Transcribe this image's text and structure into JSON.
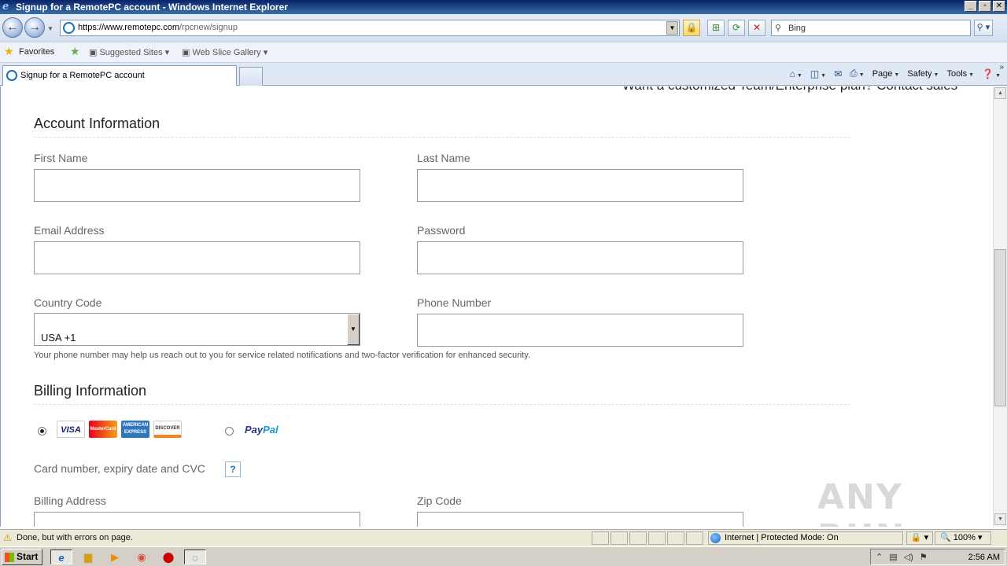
{
  "window": {
    "title": "Signup for a RemotePC account - Windows Internet Explorer",
    "buttons": [
      "_",
      "▫",
      "✕"
    ]
  },
  "nav": {
    "url_host": "https://www.remotepc.com",
    "url_path": "/rpcnew/signup",
    "search_placeholder": "Bing"
  },
  "favorites": {
    "favorites_label": "Favorites",
    "suggested_sites": "Suggested Sites",
    "web_slice_gallery": "Web Slice Gallery"
  },
  "tab": {
    "title": "Signup for a RemotePC account"
  },
  "commandbar": {
    "page": "Page",
    "safety": "Safety",
    "tools": "Tools"
  },
  "form": {
    "top_cutoff_text": "Want a customized Team/Enterprise plan? Contact sales",
    "account_section_title": "Account Information",
    "first_name_label": "First Name",
    "last_name_label": "Last Name",
    "email_label": "Email Address",
    "password_label": "Password",
    "country_code_label": "Country Code",
    "country_code_value": "USA +1",
    "phone_label": "Phone Number",
    "phone_hint": "Your phone number may help us reach out to you for service related notifications and two-factor verification for enhanced security.",
    "billing_section_title": "Billing Information",
    "card_visa": "VISA",
    "card_mastercard": "MasterCard",
    "card_amex": "AMERICAN EXPRESS",
    "card_discover": "DISCOVER",
    "paypal_pay": "Pay",
    "paypal_pal": "Pal",
    "card_number_label": "Card number, expiry date and CVC",
    "help_symbol": "?",
    "billing_address_label": "Billing Address",
    "zip_code_label": "Zip Code"
  },
  "watermark": "ANY RUN",
  "status": {
    "text": "Done, but with errors on page.",
    "zone": "Internet | Protected Mode: On",
    "zoom": "100%"
  },
  "taskbar": {
    "start_label": "Start",
    "clock": "2:56 AM"
  }
}
